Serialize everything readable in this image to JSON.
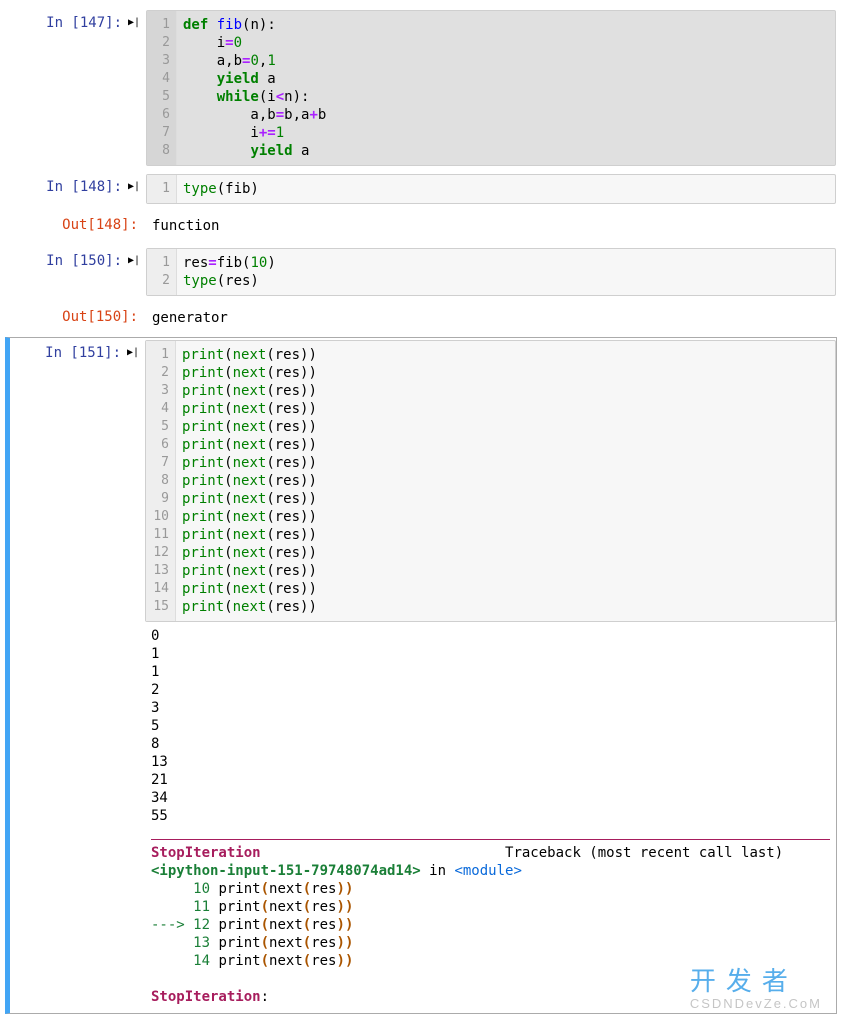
{
  "cells": [
    {
      "kind": "in",
      "num": "147",
      "running": true,
      "lines": [
        [
          {
            "c": "k",
            "t": "def"
          },
          {
            "c": "n",
            "t": " "
          },
          {
            "c": "nf",
            "t": "fib"
          },
          {
            "c": "n",
            "t": "(n):"
          }
        ],
        [
          {
            "c": "n",
            "t": "    i"
          },
          {
            "c": "o",
            "t": "="
          },
          {
            "c": "mi",
            "t": "0"
          }
        ],
        [
          {
            "c": "n",
            "t": "    a,b"
          },
          {
            "c": "o",
            "t": "="
          },
          {
            "c": "mi",
            "t": "0"
          },
          {
            "c": "n",
            "t": ","
          },
          {
            "c": "mi",
            "t": "1"
          }
        ],
        [
          {
            "c": "n",
            "t": "    "
          },
          {
            "c": "k",
            "t": "yield"
          },
          {
            "c": "n",
            "t": " a"
          }
        ],
        [
          {
            "c": "n",
            "t": "    "
          },
          {
            "c": "k",
            "t": "while"
          },
          {
            "c": "n",
            "t": "(i"
          },
          {
            "c": "o",
            "t": "<"
          },
          {
            "c": "n",
            "t": "n):"
          }
        ],
        [
          {
            "c": "n",
            "t": "        a,b"
          },
          {
            "c": "o",
            "t": "="
          },
          {
            "c": "n",
            "t": "b,a"
          },
          {
            "c": "o",
            "t": "+"
          },
          {
            "c": "n",
            "t": "b"
          }
        ],
        [
          {
            "c": "n",
            "t": "        i"
          },
          {
            "c": "o",
            "t": "+="
          },
          {
            "c": "mi",
            "t": "1"
          }
        ],
        [
          {
            "c": "n",
            "t": "        "
          },
          {
            "c": "k",
            "t": "yield"
          },
          {
            "c": "n",
            "t": " a"
          }
        ]
      ]
    },
    {
      "kind": "in",
      "num": "148",
      "lines": [
        [
          {
            "c": "bp",
            "t": "type"
          },
          {
            "c": "n",
            "t": "(fib)"
          }
        ]
      ]
    },
    {
      "kind": "out",
      "num": "148",
      "text": "function"
    },
    {
      "kind": "in",
      "num": "150",
      "lines": [
        [
          {
            "c": "n",
            "t": "res"
          },
          {
            "c": "o",
            "t": "="
          },
          {
            "c": "n",
            "t": "fib("
          },
          {
            "c": "mi",
            "t": "10"
          },
          {
            "c": "n",
            "t": ")"
          }
        ],
        [
          {
            "c": "bp",
            "t": "type"
          },
          {
            "c": "n",
            "t": "(res)"
          }
        ]
      ]
    },
    {
      "kind": "out",
      "num": "150",
      "text": "generator"
    },
    {
      "kind": "in",
      "num": "151",
      "selected": true,
      "lines": [
        [
          {
            "c": "bp",
            "t": "print"
          },
          {
            "c": "n",
            "t": "("
          },
          {
            "c": "bp",
            "t": "next"
          },
          {
            "c": "n",
            "t": "(res))"
          }
        ],
        [
          {
            "c": "bp",
            "t": "print"
          },
          {
            "c": "n",
            "t": "("
          },
          {
            "c": "bp",
            "t": "next"
          },
          {
            "c": "n",
            "t": "(res))"
          }
        ],
        [
          {
            "c": "bp",
            "t": "print"
          },
          {
            "c": "n",
            "t": "("
          },
          {
            "c": "bp",
            "t": "next"
          },
          {
            "c": "n",
            "t": "(res))"
          }
        ],
        [
          {
            "c": "bp",
            "t": "print"
          },
          {
            "c": "n",
            "t": "("
          },
          {
            "c": "bp",
            "t": "next"
          },
          {
            "c": "n",
            "t": "(res))"
          }
        ],
        [
          {
            "c": "bp",
            "t": "print"
          },
          {
            "c": "n",
            "t": "("
          },
          {
            "c": "bp",
            "t": "next"
          },
          {
            "c": "n",
            "t": "(res))"
          }
        ],
        [
          {
            "c": "bp",
            "t": "print"
          },
          {
            "c": "n",
            "t": "("
          },
          {
            "c": "bp",
            "t": "next"
          },
          {
            "c": "n",
            "t": "(res))"
          }
        ],
        [
          {
            "c": "bp",
            "t": "print"
          },
          {
            "c": "n",
            "t": "("
          },
          {
            "c": "bp",
            "t": "next"
          },
          {
            "c": "n",
            "t": "(res))"
          }
        ],
        [
          {
            "c": "bp",
            "t": "print"
          },
          {
            "c": "n",
            "t": "("
          },
          {
            "c": "bp",
            "t": "next"
          },
          {
            "c": "n",
            "t": "(res))"
          }
        ],
        [
          {
            "c": "bp",
            "t": "print"
          },
          {
            "c": "n",
            "t": "("
          },
          {
            "c": "bp",
            "t": "next"
          },
          {
            "c": "n",
            "t": "(res))"
          }
        ],
        [
          {
            "c": "bp",
            "t": "print"
          },
          {
            "c": "n",
            "t": "("
          },
          {
            "c": "bp",
            "t": "next"
          },
          {
            "c": "n",
            "t": "(res))"
          }
        ],
        [
          {
            "c": "bp",
            "t": "print"
          },
          {
            "c": "n",
            "t": "("
          },
          {
            "c": "bp",
            "t": "next"
          },
          {
            "c": "n",
            "t": "(res))"
          }
        ],
        [
          {
            "c": "bp",
            "t": "print"
          },
          {
            "c": "n",
            "t": "("
          },
          {
            "c": "bp",
            "t": "next"
          },
          {
            "c": "n",
            "t": "(res))"
          }
        ],
        [
          {
            "c": "bp",
            "t": "print"
          },
          {
            "c": "n",
            "t": "("
          },
          {
            "c": "bp",
            "t": "next"
          },
          {
            "c": "n",
            "t": "(res))"
          }
        ],
        [
          {
            "c": "bp",
            "t": "print"
          },
          {
            "c": "n",
            "t": "("
          },
          {
            "c": "bp",
            "t": "next"
          },
          {
            "c": "n",
            "t": "(res))"
          }
        ],
        [
          {
            "c": "bp",
            "t": "print"
          },
          {
            "c": "n",
            "t": "("
          },
          {
            "c": "bp",
            "t": "next"
          },
          {
            "c": "n",
            "t": "(res))"
          }
        ]
      ],
      "stdout": "0\n1\n1\n2\n3\n5\n8\n13\n21\n34\n55",
      "error": {
        "name1": "StopIteration",
        "trace_label": "Traceback (most recent call last)",
        "loc": "<ipython-input-151-79748074ad14>",
        "in_label": " in ",
        "module": "<module>",
        "frames": [
          {
            "n": "10",
            "code": "print(next(res))"
          },
          {
            "n": "11",
            "code": "print(next(res))"
          },
          {
            "n": "12",
            "code": "print(next(res))",
            "current": true
          },
          {
            "n": "13",
            "code": "print(next(res))"
          },
          {
            "n": "14",
            "code": "print(next(res))"
          }
        ],
        "name2": "StopIteration",
        "msg": ": "
      }
    }
  ],
  "watermark": {
    "main": "开发者",
    "sub": "CSDNDevZe.CoM"
  }
}
